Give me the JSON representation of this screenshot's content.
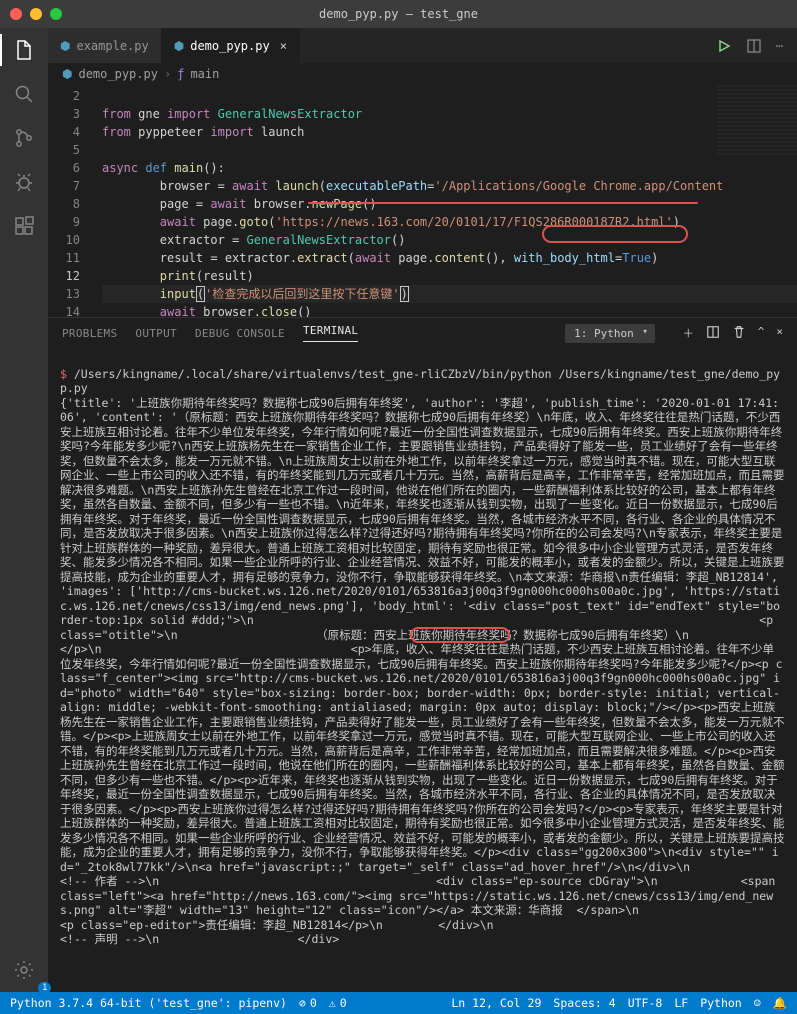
{
  "window": {
    "title": "demo_pyp.py — test_gne"
  },
  "tabs": {
    "items": [
      {
        "label": "example.py",
        "active": false
      },
      {
        "label": "demo_pyp.py",
        "active": true
      }
    ]
  },
  "breadcrumb": {
    "file": "demo_pyp.py",
    "symbol": "main"
  },
  "gutter": {
    "lines": [
      "2",
      "3",
      "4",
      "5",
      "6",
      "7",
      "8",
      "9",
      "10",
      "11",
      "12",
      "13",
      "14"
    ],
    "current": "12"
  },
  "code": {
    "l2_from": "from",
    "l2_mod": "gne",
    "l2_import": "import",
    "l2_name": "GeneralNewsExtractor",
    "l3_from": "from",
    "l3_mod": "pyppeteer",
    "l3_import": "import",
    "l3_name": "launch",
    "l5_async": "async",
    "l5_def": "def",
    "l5_name": "main",
    "l5_par": "():",
    "l6": "        browser = ",
    "l6_await": "await",
    "l6_sp": " ",
    "l6_fn": "launch",
    "l6_op": "(",
    "l6_arg": "executablePath",
    "l6_eq": "=",
    "l6_str": "'/Applications/Google Chrome.app/Content",
    "l7": "        page = ",
    "l7_await": "await",
    "l7_rest": " browser.",
    "l7_fn": "newPage",
    "l7_end": "()",
    "l8": "        ",
    "l8_await": "await",
    "l8_rest": " page.",
    "l8_fn": "goto",
    "l8_op": "(",
    "l8_str": "'https://news.163.com/20/0101/17/F1QS286R000187R2.html'",
    "l8_cl": ")",
    "l9": "        extractor = ",
    "l9_cls": "GeneralNewsExtractor",
    "l9_end": "()",
    "l10": "        result = extractor.",
    "l10_fn": "extract",
    "l10_op": "(",
    "l10_await": "await",
    "l10_rest": " page.",
    "l10_fn2": "content",
    "l10_mid": "(), ",
    "l10_arg": "with_body_html",
    "l10_eq": "=",
    "l10_true": "True",
    "l10_cl": ")",
    "l11": "        ",
    "l11_fn": "print",
    "l11_rest": "(result)",
    "l12": "        ",
    "l12_fn": "input",
    "l12_op": "(",
    "l12_str": "'检查完成以后回到这里按下任意键'",
    "l12_cl": ")",
    "l13": "        ",
    "l13_await": "await",
    "l13_rest": " browser.",
    "l13_fn": "close",
    "l13_end": "()"
  },
  "panel": {
    "tabs": {
      "problems": "Problems",
      "output": "Output",
      "debug": "Debug Console",
      "terminal": "Terminal"
    },
    "selector": "1: Python",
    "icons": {
      "new": "+",
      "split": "▥",
      "trash": "🗑",
      "max": "^",
      "close": "×"
    }
  },
  "terminal": {
    "prompt": "$",
    "cmd": " /Users/kingname/.local/share/virtualenvs/test_gne-rliCZbzV/bin/python /Users/kingname/test_gne/demo_pyp.py",
    "body": "{'title': '上班族你期待年终奖吗？数据称七成90后拥有年终奖', 'author': '李超', 'publish_time': '2020-01-01 17:41:06', 'content': '（原标题：西安上班族你期待年终奖吗？数据称七成90后拥有年终奖）\\n年底，收入、年终奖往往是热门话题，不少西安上班族互相讨论着。往年不少单位发年终奖，今年行情如何呢?最近一份全国性调查数据显示，七成90后拥有年终奖。西安上班族你期待年终奖吗?今年能发多少呢?\\n西安上班族杨先生在一家销售企业工作，主要跟销售业绩挂钩，产品卖得好了能发一些，员工业绩好了会有一些年终奖，但数量不会太多，能发一万元就不错。\\n上班族周女士以前在外地工作，以前年终奖拿过一万元，感觉当时真不错。现在，可能大型互联网企业、一些上市公司的收入还不错，有的年终奖能到几万元或者几十万元。当然，高薪背后是高辛，工作非常辛苦，经常加班加点，而且需要解决很多难题。\\n西安上班族孙先生曾经在北京工作过一段时间，他说在他们所在的圈内，一些薪酬福利体系比较好的公司，基本上都有年终奖，虽然各自数量、金额不同，但多少有一些也不错。\\n近年来，年终奖也逐渐从钱到实物，出现了一些变化。近日一份数据显示，七成90后拥有年终奖。对于年终奖，最近一份全国性调查数据显示，七成90后拥有年终奖。当然，各城市经济水平不同，各行业、各企业的具体情况不同，是否发放取决于很多因素。\\n西安上班族你过得怎么样?过得还好吗?期待拥有年终奖吗?你所在的公司会发吗?\\n专家表示，年终奖主要是针对上班族群体的一种奖励，差异很大。普通上班族工资相对比较固定，期待有奖励也很正常。如今很多中小企业管理方式灵活，是否发年终奖、能发多少情况各不相同。如果一些企业所呼的行业、企业经营情况、效益不好，可能发的概率小，或者发的金额少。所以，关键是上班族要提高技能，成为企业的重要人才，拥有足够的竞争力，没你不行，争取能够获得年终奖。\\n本文来源：华商报\\n责任编辑：李超_NB12814', 'images': ['http://cms-bucket.ws.126.net/2020/0101/653816a3j00q3f9gn000hc000hs00a0c.jpg', 'https://static.ws.126.net/cnews/css13/img/end_news.png'], 'body_html': '<div class=\"post_text\" id=\"endText\" style=\"border-top:1px solid #ddd;\">\\n                                                                         <p class=\"otitle\">\\n                    （原标题：西安上班族你期待年终奖吗？数据称七成90后拥有年终奖）\\n                </p>\\n                                    <p>年底，收入、年终奖往往是热门话题，不少西安上班族互相讨论着。往年不少单位发年终奖，今年行情如何呢?最近一份全国性调查数据显示，七成90后拥有年终奖。西安上班族你期待年终奖吗?今年能发多少呢?</p><p class=\"f_center\"><img src=\"http://cms-bucket.ws.126.net/2020/0101/653816a3j00q3f9gn000hc000hs00a0c.jpg\" id=\"photo\" width=\"640\" style=\"box-sizing: border-box; border-width: 0px; border-style: initial; vertical-align: middle; -webkit-font-smoothing: antialiased; margin: 0px auto; display: block;\"/></p><p>西安上班族杨先生在一家销售企业工作，主要跟销售业绩挂钩，产品卖得好了能发一些，员工业绩好了会有一些年终奖，但数量不会太多，能发一万元就不错。</p><p>上班族周女士以前在外地工作，以前年终奖拿过一万元，感觉当时真不错。现在，可能大型互联网企业、一些上市公司的收入还不错，有的年终奖能到几万元或者几十万元。当然，高薪背后是高辛，工作非常辛苦，经常加班加点，而且需要解决很多难题。</p><p>西安上班族孙先生曾经在北京工作过一段时间，他说在他们所在的圈内，一些薪酬福利体系比较好的公司，基本上都有年终奖，虽然各自数量、金额不同，但多少有一些也不错。</p><p>近年来，年终奖也逐渐从钱到实物，出现了一些变化。近日一份数据显示，七成90后拥有年终奖。对于年终奖，最近一份全国性调查数据显示，七成90后拥有年终奖。当然，各城市经济水平不同，各行业、各企业的具体情况不同，是否发放取决于很多因素。</p><p>西安上班族你过得怎么样?过得还好吗?期待拥有年终奖吗?你所在的公司会发吗?</p><p>专家表示，年终奖主要是针对上班族群体的一种奖励，差异很大。普通上班族工资相对比较固定，期待有奖励也很正常。如今很多中小企业管理方式灵活，是否发年终奖、能发多少情况各不相同。如果一些企业所呼的行业、企业经营情况、效益不好，可能发的概率小，或者发的金额少。所以，关键是上班族要提高技能，成为企业的重要人才，拥有足够的竞争力，没你不行，争取能够获得年终奖。</p><div class=\"gg200x300\">\\n<div style=\"\" id=\"_2tok8wl77kk\"/>\\n<a href=\"javascript:;\" target=\"_self\" class=\"ad_hover_href\"/>\\n</div>\\n                                                      <!-- 作者 -->\\n                                        <div class=\"ep-source cDGray\">\\n            <span class=\"left\"><a href=\"http://news.163.com/\"><img src=\"https://static.ws.126.net/cnews/css13/img/end_news.png\" alt=\"李超\" width=\"13\" height=\"12\" class=\"icon\"/></a> 本文来源：华商报  </span>\\n                        <p class=\"ep-editor\">责任编辑：李超_NB12814</p>\\n        </div>\\n                                                                <!-- 声明 -->\\n                    </div>"
  },
  "statusbar": {
    "python": "Python 3.7.4 64-bit ('test_gne': pipenv)",
    "errors": "0",
    "warnings": "0",
    "lncol": "Ln 12, Col 29",
    "spaces": "Spaces: 4",
    "encoding": "UTF-8",
    "eol": "LF",
    "lang": "Python",
    "smile": "☺",
    "bell": "🔔"
  },
  "activity_badge": "1"
}
